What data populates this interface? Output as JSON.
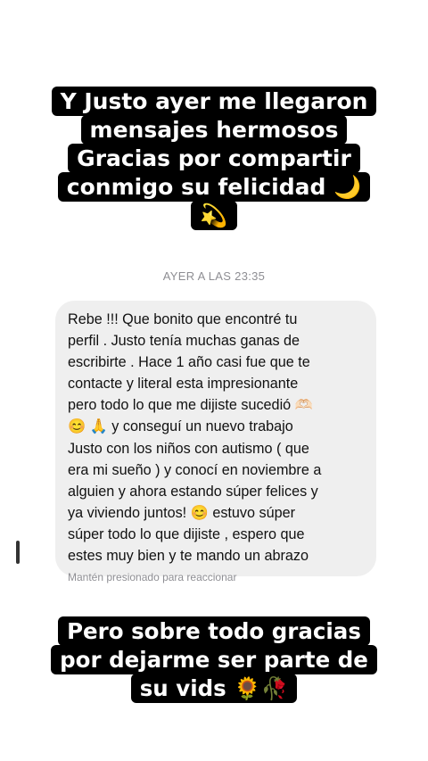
{
  "top_caption": {
    "lines": [
      "Y Justo ayer me llegaron",
      "mensajes hermosos",
      "Gracias por compartir",
      "conmigo su felicidad 🌙",
      "💫"
    ]
  },
  "chat": {
    "timestamp": "AYER A LAS 23:35",
    "message_lines": [
      "Rebe !!! Que bonito que encontré tu",
      "perfil . Justo tenía muchas ganas de",
      "escribirte . Hace 1 año casi fue que te",
      "contacte y literal esta impresionante",
      "pero todo lo que me dijiste sucedió 🫶🏻",
      "😊 🙏 y conseguí un nuevo trabajo",
      "Justo con los niños con autismo ( que",
      "era mi sueño ) y conocí en noviembre a",
      "alguien y ahora estando súper felices y",
      "ya viviendo juntos! 😊 estuvo súper",
      "súper todo lo que dijiste , espero que",
      "estes muy bien y te mando un abrazo"
    ],
    "react_hint": "Mantén presionado para reaccionar"
  },
  "bottom_caption": {
    "lines": [
      "Pero sobre todo gracias",
      "por dejarme ser parte de",
      "su vids 🌻🥀"
    ]
  }
}
